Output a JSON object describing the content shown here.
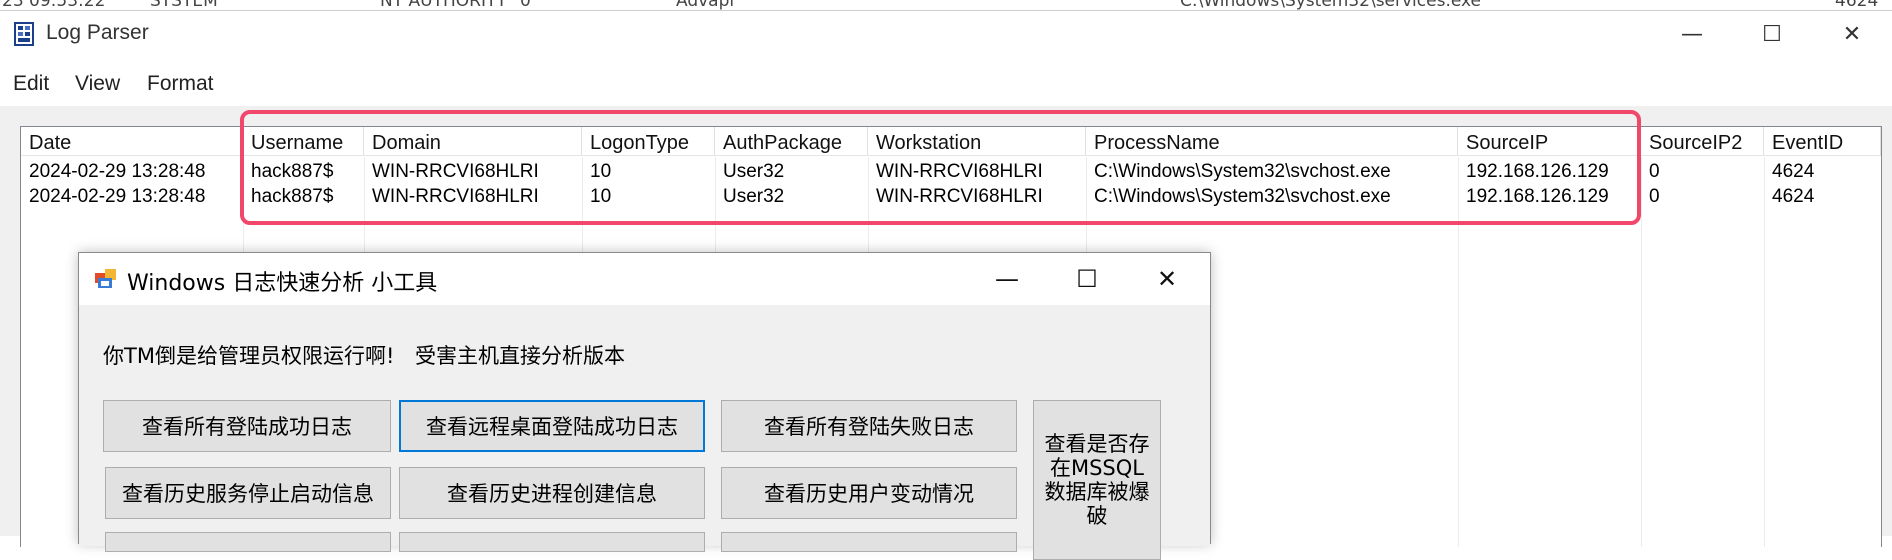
{
  "background_window": {
    "fragments": [
      "23 09:53:22",
      "SYSTEM",
      "NT AUTHORITY",
      "0",
      "Advapi",
      "C:\\Windows\\System32\\services.exe",
      "4624"
    ]
  },
  "window": {
    "title": "Log Parser",
    "controls": {
      "minimize": "—",
      "maximize": "☐",
      "close": "✕"
    }
  },
  "menu": [
    "Edit",
    "View",
    "Format"
  ],
  "table": {
    "columns": [
      "Date",
      "Username",
      "Domain",
      "LogonType",
      "AuthPackage",
      "Workstation",
      "ProcessName",
      "SourceIP",
      "SourceIP2",
      "EventID"
    ],
    "rows": [
      [
        "2024-02-29 13:28:48",
        "hack887$",
        "WIN-RRCVI68HLRI",
        "10",
        "User32",
        "WIN-RRCVI68HLRI",
        "C:\\Windows\\System32\\svchost.exe",
        "192.168.126.129",
        "0",
        "4624"
      ],
      [
        "2024-02-29 13:28:48",
        "hack887$",
        "WIN-RRCVI68HLRI",
        "10",
        "User32",
        "WIN-RRCVI68HLRI",
        "C:\\Windows\\System32\\svchost.exe",
        "192.168.126.129",
        "0",
        "4624"
      ]
    ]
  },
  "highlight_color": "#f0476a",
  "tool_window": {
    "title": "Windows 日志快速分析 小工具",
    "controls": {
      "minimize": "—",
      "maximize": "☐",
      "close": "✕"
    },
    "admin_warning": "你TM倒是给管理员权限运行啊!",
    "version_label": "受害主机直接分析版本",
    "buttons": {
      "all_success": "查看所有登陆成功日志",
      "rdp_success": "查看远程桌面登陆成功日志",
      "all_fail": "查看所有登陆失败日志",
      "service_history": "查看历史服务停止启动信息",
      "process_history": "查看历史进程创建信息",
      "user_changes": "查看历史用户变动情况",
      "mssql_bruteforce": "查看是否存在MSSQL数据库被爆破"
    }
  }
}
